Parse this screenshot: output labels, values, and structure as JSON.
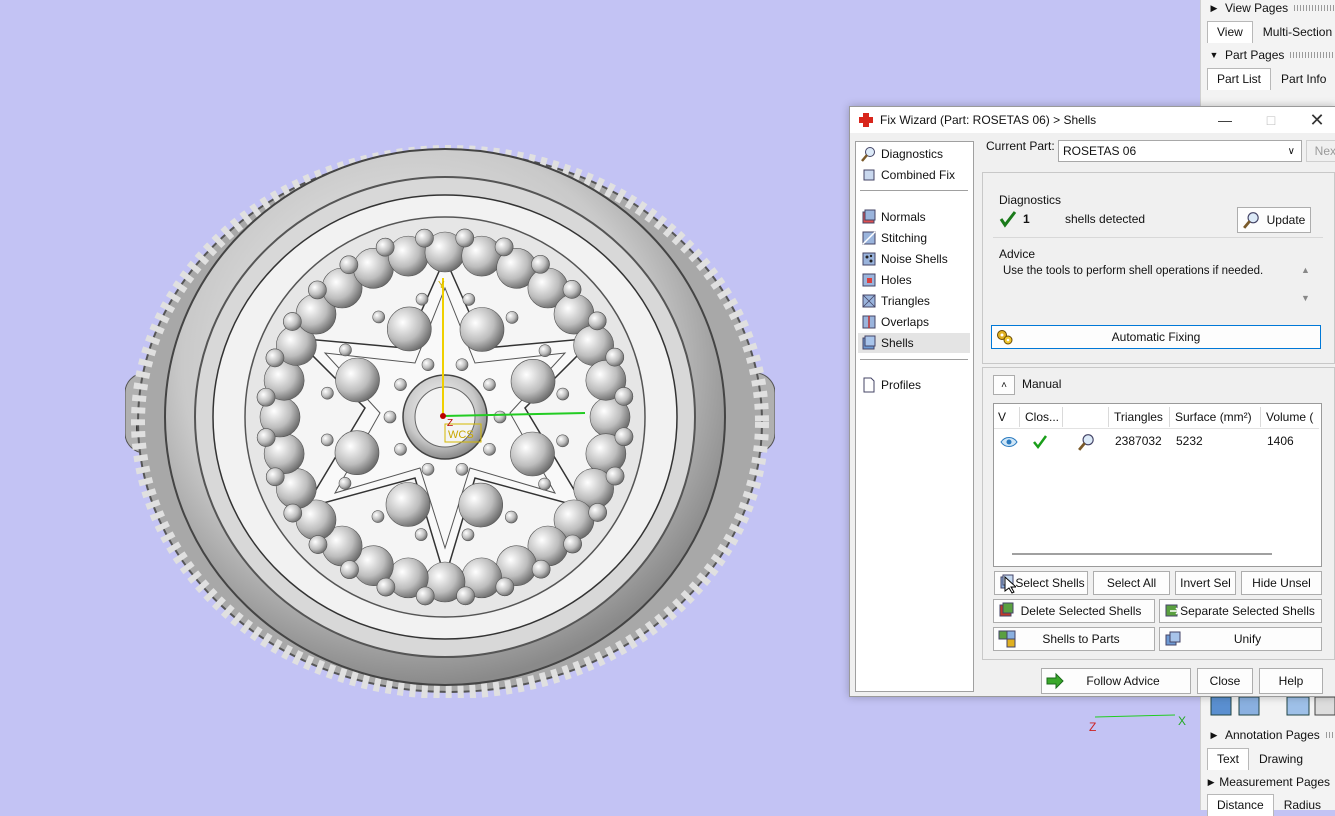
{
  "viewport": {
    "wcs_label": "WCS",
    "axis_z": "Z",
    "axis_x": "X",
    "axis_y": "Y"
  },
  "side_panel": {
    "view_pages": {
      "title": "View Pages",
      "tabs": [
        "View",
        "Multi-Section"
      ]
    },
    "part_pages": {
      "title": "Part Pages",
      "tabs": [
        "Part List",
        "Part Info"
      ]
    },
    "annotation_pages": {
      "title": "Annotation Pages",
      "tabs": [
        "Text",
        "Drawing"
      ]
    },
    "measurement_pages": {
      "title": "Measurement Pages",
      "tabs": [
        "Distance",
        "Radius"
      ]
    }
  },
  "dialog": {
    "title": "Fix Wizard (Part: ROSETAS 06) > Shells",
    "nav": {
      "top": [
        "Diagnostics",
        "Combined Fix"
      ],
      "fixes": [
        "Normals",
        "Stitching",
        "Noise Shells",
        "Holes",
        "Triangles",
        "Overlaps",
        "Shells"
      ],
      "bottom": [
        "Profiles"
      ],
      "selected": "Shells"
    },
    "current_part_label": "Current Part:",
    "current_part_value": "ROSETAS 06",
    "next_label": "Next",
    "diagnostics": {
      "heading": "Diagnostics",
      "count": "1",
      "message": "shells detected",
      "update_label": "Update"
    },
    "advice": {
      "heading": "Advice",
      "text": "Use the tools to perform shell operations if needed."
    },
    "automatic_fixing_label": "Automatic Fixing",
    "manual": {
      "heading": "Manual",
      "columns": [
        "V",
        "Clos...",
        "",
        "Triangles",
        "Surface (mm²)",
        "Volume ("
      ],
      "rows": [
        {
          "triangles": "2387032",
          "surface": "5232",
          "volume": "1406"
        }
      ],
      "buttons": {
        "select_shells": "Select Shells",
        "select_all": "Select All",
        "invert_sel": "Invert Sel",
        "hide_unsel": "Hide Unsel",
        "delete_selected": "Delete Selected Shells",
        "separate_selected": "Separate Selected Shells",
        "shells_to_parts": "Shells to Parts",
        "unify": "Unify"
      }
    },
    "footer": {
      "follow_advice": "Follow Advice",
      "close": "Close",
      "help": "Help"
    }
  },
  "colors": {
    "viewport_bg": "#c3c3f4",
    "accent": "#0078d7",
    "check_green": "#1a9e1a",
    "axis_yellow": "#f0d000",
    "axis_green": "#22cc22"
  }
}
